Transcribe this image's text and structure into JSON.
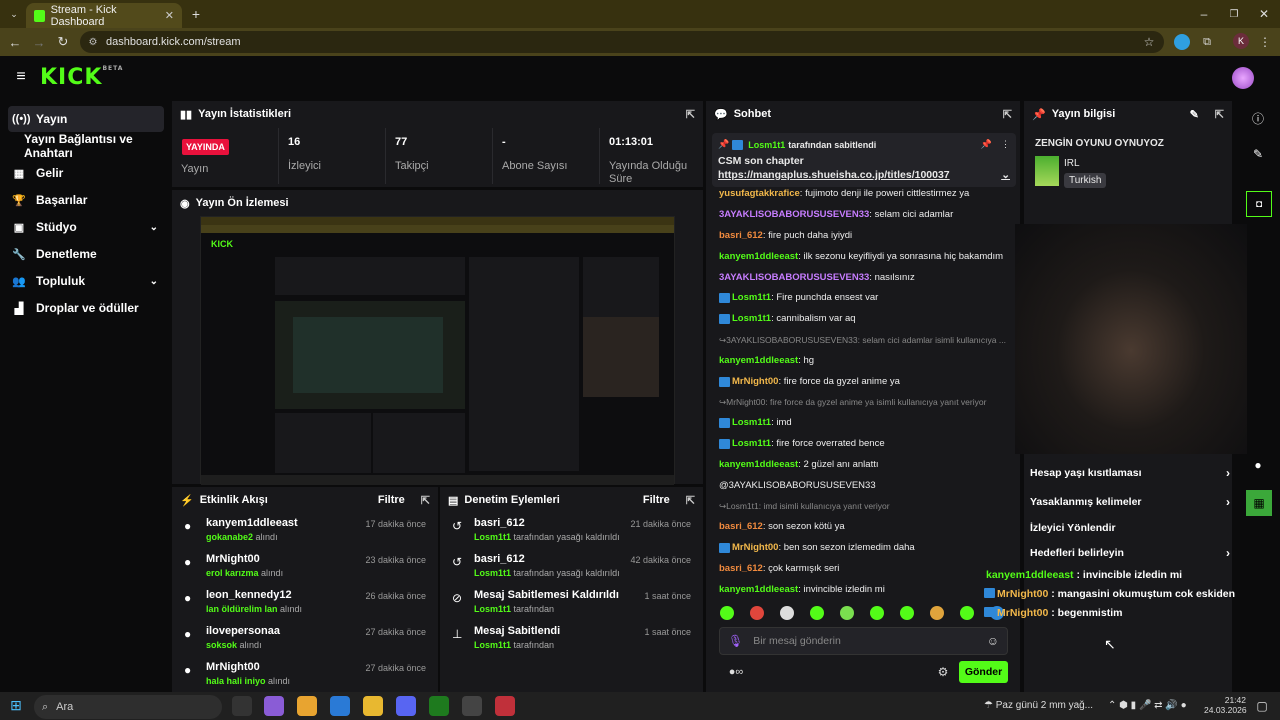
{
  "browser": {
    "tab_title": "Stream - Kick Dashboard",
    "url": "dashboard.kick.com/stream",
    "profile_letter": "K"
  },
  "header": {
    "logo": "KICK",
    "logo_badge": "BETA"
  },
  "sidebar": {
    "items": [
      {
        "label": "Yayın",
        "icon": "broadcast-icon"
      },
      {
        "label": "Yayın Bağlantısı ve Anahtarı",
        "icon": ""
      },
      {
        "label": "Gelir",
        "icon": "dollar-icon"
      },
      {
        "label": "Başarılar",
        "icon": "trophy-icon"
      },
      {
        "label": "Stüdyo",
        "icon": "grid-icon"
      },
      {
        "label": "Denetleme",
        "icon": "wrench-icon"
      },
      {
        "label": "Topluluk",
        "icon": "users-icon"
      },
      {
        "label": "Droplar ve ödüller",
        "icon": "gift-icon"
      }
    ]
  },
  "stats": {
    "title": "Yayın İstatistikleri",
    "live_badge": "YAYINDA",
    "items": [
      {
        "value": "",
        "label": "Yayın"
      },
      {
        "value": "16",
        "label": "İzleyici"
      },
      {
        "value": "77",
        "label": "Takipçi"
      },
      {
        "value": "-",
        "label": "Abone Sayısı"
      },
      {
        "value": "01:13:01",
        "label": "Yayında Olduğu Süre"
      }
    ]
  },
  "preview": {
    "title": "Yayın Ön İzlemesi"
  },
  "activity": {
    "title": "Etkinlik Akışı",
    "filter": "Filtre",
    "rows": [
      {
        "name": "kanyem1ddleeast",
        "by": "gokanabe2",
        "action": "alındı",
        "time": "17 dakika önce"
      },
      {
        "name": "MrNight00",
        "by": "erol karızma",
        "action": "alındı",
        "time": "23 dakika önce"
      },
      {
        "name": "leon_kennedy12",
        "by": "lan öldürelim lan",
        "action": "alındı",
        "time": "26 dakika önce"
      },
      {
        "name": "ilovepersonaa",
        "by": "soksok",
        "action": "alındı",
        "time": "27 dakika önce"
      },
      {
        "name": "MrNight00",
        "by": "hala hali iniyo",
        "action": "alındı",
        "time": "27 dakika önce"
      }
    ]
  },
  "moderation": {
    "title": "Denetim Eylemleri",
    "filter": "Filtre",
    "rows": [
      {
        "name": "basri_612",
        "by": "Losm1t1",
        "action": "tarafından yasağı kaldırıldı",
        "time": "21 dakika önce"
      },
      {
        "name": "basri_612",
        "by": "Losm1t1",
        "action": "tarafından yasağı kaldırıldı",
        "time": "42 dakika önce"
      },
      {
        "name": "Mesaj Sabitlemesi Kaldırıldı",
        "by": "Losm1t1",
        "action": "tarafından",
        "time": "1 saat önce"
      },
      {
        "name": "Mesaj Sabitlendi",
        "by": "Losm1t1",
        "action": "tarafından",
        "time": "1 saat önce"
      }
    ]
  },
  "chat": {
    "title": "Sohbet",
    "pinned_by": "Losm1t1",
    "pinned_suffix": "tarafından sabitlendi",
    "pinned_text": "CSM son chapter",
    "pinned_link": "https://mangaplus.shueisha.co.jp/titles/100037",
    "messages": [
      {
        "user": "yusufagtakkrafice",
        "color": "#f2b84b",
        "text": "fujimoto denji ile poweri cittlestirmez ya",
        "badge": false
      },
      {
        "user": "3AYAKLISOBABORUSUSEVEN33",
        "color": "#c77dff",
        "text": "selam cici adamlar",
        "badge": false
      },
      {
        "user": "basri_612",
        "color": "#f08a3e",
        "text": "fire puch daha iyiydi",
        "badge": false
      },
      {
        "user": "kanyem1ddleeast",
        "color": "#53fc18",
        "text": "ilk sezonu keyifliydi ya sonrasına hiç bakamdım",
        "badge": false
      },
      {
        "user": "3AYAKLISOBABORUSUSEVEN33",
        "color": "#c77dff",
        "text": "nasılsınız",
        "badge": false
      },
      {
        "user": "Losm1t1",
        "color": "#53fc18",
        "text": "Fire punchda ensest var",
        "badge": true
      },
      {
        "user": "Losm1t1",
        "color": "#53fc18",
        "text": "cannibalism var aq",
        "badge": true
      },
      {
        "reply": "3AYAKLISOBABORUSUSEVEN33: selam cici adamlar isimli kullanıcıya ..."
      },
      {
        "user": "kanyem1ddleeast",
        "color": "#53fc18",
        "text": "hg",
        "badge": false
      },
      {
        "user": "MrNight00",
        "color": "#f2b84b",
        "text": "fire force da gyzel anime ya",
        "badge": true
      },
      {
        "reply": "MrNight00: fire force da gyzel anime ya isimli kullanıcıya yanıt veriyor"
      },
      {
        "user": "Losm1t1",
        "color": "#53fc18",
        "text": "imd",
        "badge": true
      },
      {
        "user": "Losm1t1",
        "color": "#53fc18",
        "text": "fire force overrated bence",
        "badge": true
      },
      {
        "user": "kanyem1ddleeast",
        "color": "#53fc18",
        "text": "2 güzel anı anlattı",
        "badge": false
      },
      {
        "plain": "@3AYAKLISOBABORUSUSEVEN33"
      },
      {
        "reply": "Losm1t1: imd isimli kullanıcıya yanıt veriyor"
      },
      {
        "user": "basri_612",
        "color": "#f08a3e",
        "text": "son sezon kötü ya",
        "badge": false
      },
      {
        "user": "MrNight00",
        "color": "#f2b84b",
        "text": "ben son sezon izlemedim daha",
        "badge": true
      },
      {
        "user": "basri_612",
        "color": "#f08a3e",
        "text": "çok karmışık seri",
        "badge": false
      },
      {
        "user": "kanyem1ddleeast",
        "color": "#53fc18",
        "text": "invincible izledin mi",
        "badge": false
      },
      {
        "user": "MrNight00",
        "color": "#f2b84b",
        "text": "mangasini okumuştum cok eskiden",
        "badge": true
      },
      {
        "user": "MrNight00",
        "color": "#f2b84b",
        "text": "begenmistim",
        "badge": true
      }
    ],
    "input_placeholder": "Bir mesaj gönderin",
    "send": "Gönder"
  },
  "info": {
    "title": "Yayın bilgisi",
    "stream_title": "ZENGİN OYUNU OYNUYOZ",
    "category": "IRL",
    "language": "Turkish"
  },
  "menu": [
    {
      "label": "Hesap yaşı kısıtlaması",
      "arrow": true
    },
    {
      "label": "Yasaklanmış kelimeler",
      "arrow": true
    },
    {
      "label": "İzleyici Yönlendir",
      "arrow": false
    },
    {
      "label": "Hedefleri belirleyin",
      "arrow": true
    }
  ],
  "overlay_chat": [
    {
      "user": "kanyem1ddleeast",
      "color": "#53fc18",
      "text": ": invincible izledin mi",
      "badge": false
    },
    {
      "user": "MrNight00",
      "color": "#f2b84b",
      "text": ": mangasini okumuştum cok eskiden",
      "badge": true
    },
    {
      "user": "MrNight00",
      "color": "#f2b84b",
      "text": ": begenmistim",
      "badge": true
    }
  ],
  "taskbar": {
    "search": "Ara",
    "weather": "Paz günü 2 mm yağ...",
    "time": "21:42",
    "date": "24.03.2026"
  }
}
